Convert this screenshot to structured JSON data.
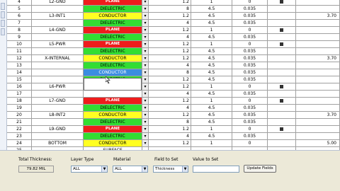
{
  "table": {
    "rows": [
      {
        "num": "4",
        "name": "L2-GND",
        "type": "PLANE",
        "thickness": "1.2",
        "dk": "1",
        "loss_tangent": "0",
        "checked": true,
        "impedance": ""
      },
      {
        "num": "5",
        "name": "",
        "type": "DIELECTRIC",
        "thickness": "8",
        "dk": "4.5",
        "loss_tangent": "0.035",
        "checked": false,
        "impedance": ""
      },
      {
        "num": "6",
        "name": "L3-INT1",
        "type": "CONDUCTOR",
        "thickness": "1.2",
        "dk": "4.5",
        "loss_tangent": "0.035",
        "checked": false,
        "impedance": "3.70"
      },
      {
        "num": "7",
        "name": "",
        "type": "DIELECTRIC",
        "thickness": "4",
        "dk": "4.5",
        "loss_tangent": "0.035",
        "checked": false,
        "impedance": ""
      },
      {
        "num": "8",
        "name": "L4-GND",
        "type": "PLANE",
        "thickness": "1.2",
        "dk": "1",
        "loss_tangent": "0",
        "checked": true,
        "impedance": ""
      },
      {
        "num": "9",
        "name": "",
        "type": "DIELECTRIC",
        "thickness": "4",
        "dk": "4.5",
        "loss_tangent": "0.035",
        "checked": false,
        "impedance": ""
      },
      {
        "num": "10",
        "name": "L5-PWR",
        "type": "PLANE",
        "thickness": "1.2",
        "dk": "1",
        "loss_tangent": "0",
        "checked": true,
        "impedance": ""
      },
      {
        "num": "11",
        "name": "",
        "type": "DIELECTRIC",
        "thickness": "1.2",
        "dk": "4.5",
        "loss_tangent": "0.035",
        "checked": false,
        "impedance": ""
      },
      {
        "num": "12",
        "name": "X-INTERNAL",
        "type": "CONDUCTOR",
        "thickness": "1.2",
        "dk": "4.5",
        "loss_tangent": "0.035",
        "checked": false,
        "impedance": "3.70"
      },
      {
        "num": "13",
        "name": "",
        "type": "DIELECTRIC",
        "thickness": "4",
        "dk": "4.5",
        "loss_tangent": "0.035",
        "checked": false,
        "impedance": ""
      },
      {
        "num": "14",
        "name": "",
        "type": "CONDUCTOR",
        "thickness": "8",
        "dk": "4.5",
        "loss_tangent": "0.035",
        "checked": false,
        "impedance": "",
        "selected": true
      },
      {
        "num": "15",
        "name": "",
        "type": "DIELECTRIC",
        "thickness": "1.2",
        "dk": "4.5",
        "loss_tangent": "0.035",
        "checked": false,
        "impedance": ""
      },
      {
        "num": "16",
        "name": "L6-PWR",
        "type": "",
        "thickness": "1.2",
        "dk": "1",
        "loss_tangent": "0",
        "checked": true,
        "impedance": ""
      },
      {
        "num": "17",
        "name": "",
        "type": "",
        "thickness": "4",
        "dk": "4.5",
        "loss_tangent": "0.035",
        "checked": false,
        "impedance": ""
      },
      {
        "num": "18",
        "name": "L7-GND",
        "type": "PLANE",
        "thickness": "1.2",
        "dk": "1",
        "loss_tangent": "0",
        "checked": true,
        "impedance": ""
      },
      {
        "num": "19",
        "name": "",
        "type": "DIELECTRIC",
        "thickness": "4",
        "dk": "4.5",
        "loss_tangent": "0.035",
        "checked": false,
        "impedance": ""
      },
      {
        "num": "20",
        "name": "L8-INT2",
        "type": "CONDUCTOR",
        "thickness": "1.2",
        "dk": "4.5",
        "loss_tangent": "0.035",
        "checked": false,
        "impedance": "3.70"
      },
      {
        "num": "21",
        "name": "",
        "type": "DIELECTRIC",
        "thickness": "8",
        "dk": "4.5",
        "loss_tangent": "0.035",
        "checked": false,
        "impedance": ""
      },
      {
        "num": "22",
        "name": "L9-GND",
        "type": "PLANE",
        "thickness": "1.2",
        "dk": "1",
        "loss_tangent": "0",
        "checked": true,
        "impedance": ""
      },
      {
        "num": "23",
        "name": "",
        "type": "DIELECTRIC",
        "thickness": "4",
        "dk": "4.5",
        "loss_tangent": "0.035",
        "checked": false,
        "impedance": ""
      },
      {
        "num": "24",
        "name": "BOTTOM",
        "type": "CONDUCTOR",
        "thickness": "1.2",
        "dk": "1",
        "loss_tangent": "0",
        "checked": false,
        "impedance": "5.00"
      },
      {
        "num": "25",
        "name": "",
        "type": "SURFACE",
        "thickness": "",
        "dk": "",
        "loss_tangent": "",
        "checked": false,
        "impedance": "",
        "no_dropdown": true
      }
    ]
  },
  "dropdown_open": {
    "options": [
      "",
      ""
    ]
  },
  "bottom": {
    "total_thickness_label": "Total Thickness:",
    "total_thickness_value": "79.82 MIL",
    "layer_type_label": "Layer Type",
    "layer_type_value": "ALL",
    "material_label": "Material",
    "material_value": "ALL",
    "field_to_set_label": "Field to Set",
    "field_to_set_value": "Thickness",
    "value_to_set_label": "Value to Set",
    "value_to_set_value": "",
    "update_button": "Update Fields"
  },
  "colors": {
    "plane": "#ee1c1c",
    "dielectric": "#33dd33",
    "conductor": "#ffff22",
    "selected": "#3b8de0"
  },
  "icons": {
    "dropdown": "down-arrow",
    "checkbox": "checkbox",
    "cursor": "arrow-cursor"
  }
}
